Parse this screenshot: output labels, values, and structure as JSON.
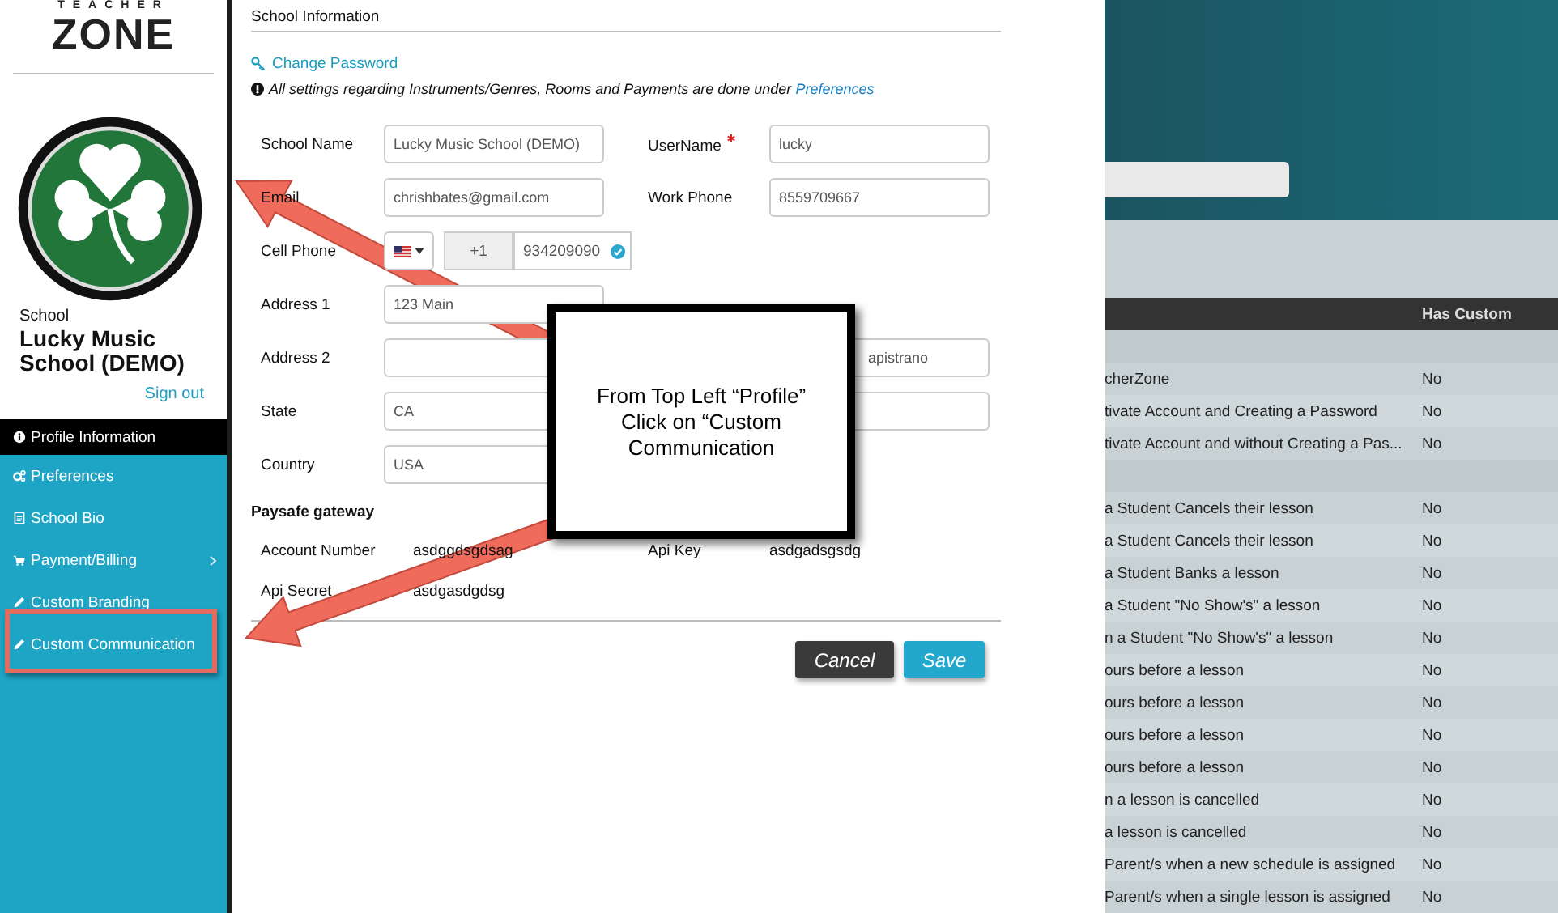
{
  "sidebar": {
    "logo": {
      "small": "TEACHER",
      "large": "ZONE"
    },
    "school_caption": "School",
    "school_name": "Lucky Music School (DEMO)",
    "sign_out": "Sign out",
    "menu": [
      {
        "label": "Profile Information",
        "selected": true,
        "expandable": false
      },
      {
        "label": "Preferences",
        "selected": false,
        "expandable": false
      },
      {
        "label": "School Bio",
        "selected": false,
        "expandable": false
      },
      {
        "label": "Payment/Billing",
        "selected": false,
        "expandable": true
      },
      {
        "label": "Custom Branding",
        "selected": false,
        "expandable": false
      },
      {
        "label": "Custom Communication",
        "selected": false,
        "expandable": false,
        "highlighted": true
      }
    ]
  },
  "form": {
    "subtitle": "School Information",
    "change_password": "Change Password",
    "notice": "All settings regarding Instruments/Genres, Rooms and Payments are done under",
    "notice_link": "Preferences",
    "rows": [
      {
        "kind": "pair",
        "left": {
          "label": "School Name",
          "value": "Lucky Music School (DEMO)"
        },
        "right": {
          "label": "UserName",
          "value": "lucky",
          "required": true
        }
      },
      {
        "kind": "pair",
        "left": {
          "label": "Email",
          "value": "chrishbates@gmail.com"
        },
        "right": {
          "label": "Work Phone",
          "value": "8559709667"
        }
      },
      {
        "kind": "phone",
        "label": "Cell Phone",
        "code": "+1",
        "value": "934209090",
        "verified": true
      },
      {
        "kind": "pair",
        "left": {
          "label": "Address 1",
          "value": "123 Main"
        }
      },
      {
        "kind": "pair",
        "left": {
          "label": "Address 2"
        },
        "right": {
          "value": "apistrano"
        }
      },
      {
        "kind": "pair",
        "left": {
          "label": "State",
          "value": "CA"
        },
        "right_field": true
      },
      {
        "kind": "pair",
        "left": {
          "label": "Country",
          "value": "USA"
        }
      }
    ],
    "gateway_title": "Paysafe gateway",
    "gateway": [
      {
        "label": "Account Number",
        "value": "asdggdsgdsag"
      },
      {
        "label": "Api Key",
        "value": "asdgadsgsdg"
      },
      {
        "label": "Api Secret",
        "value": "asdgasdgdsg"
      }
    ],
    "buttons": [
      {
        "kind": "cancel",
        "label": "Cancel"
      },
      {
        "kind": "save",
        "label": "Save"
      }
    ]
  },
  "callout": "From Top Left “Profile” Click on “Custom Communication",
  "background_table": {
    "columns": [
      "Has Custom"
    ],
    "rows": [
      {
        "kind": "group"
      },
      {
        "kind": "row",
        "cells": [
          "cherZone",
          "No"
        ]
      },
      {
        "kind": "row",
        "cells": [
          "tivate Account and Creating a Password",
          "No"
        ]
      },
      {
        "kind": "row",
        "cells": [
          "tivate Account and without Creating a Pas...",
          "No"
        ]
      },
      {
        "kind": "group"
      },
      {
        "kind": "row",
        "cells": [
          "a Student Cancels their lesson",
          "No"
        ]
      },
      {
        "kind": "row",
        "cells": [
          "a Student Cancels their lesson",
          "No"
        ]
      },
      {
        "kind": "row",
        "cells": [
          "a Student Banks a lesson",
          "No"
        ]
      },
      {
        "kind": "row",
        "cells": [
          "a Student \"No Show's\" a lesson",
          "No"
        ]
      },
      {
        "kind": "row",
        "cells": [
          "n a Student \"No Show's\" a lesson",
          "No"
        ]
      },
      {
        "kind": "row",
        "cells": [
          "ours before a lesson",
          "No"
        ]
      },
      {
        "kind": "row",
        "cells": [
          "ours before a lesson",
          "No"
        ]
      },
      {
        "kind": "row",
        "cells": [
          "ours before a lesson",
          "No"
        ]
      },
      {
        "kind": "row",
        "cells": [
          "ours before a lesson",
          "No"
        ]
      },
      {
        "kind": "row",
        "cells": [
          "n a lesson is cancelled",
          "No"
        ]
      },
      {
        "kind": "row",
        "cells": [
          "a lesson is cancelled",
          "No"
        ]
      },
      {
        "kind": "row",
        "cells": [
          "Parent/s when a new schedule is assigned",
          "No"
        ]
      },
      {
        "kind": "row",
        "cells": [
          "Parent/s when a single lesson is assigned",
          "No"
        ]
      }
    ]
  }
}
